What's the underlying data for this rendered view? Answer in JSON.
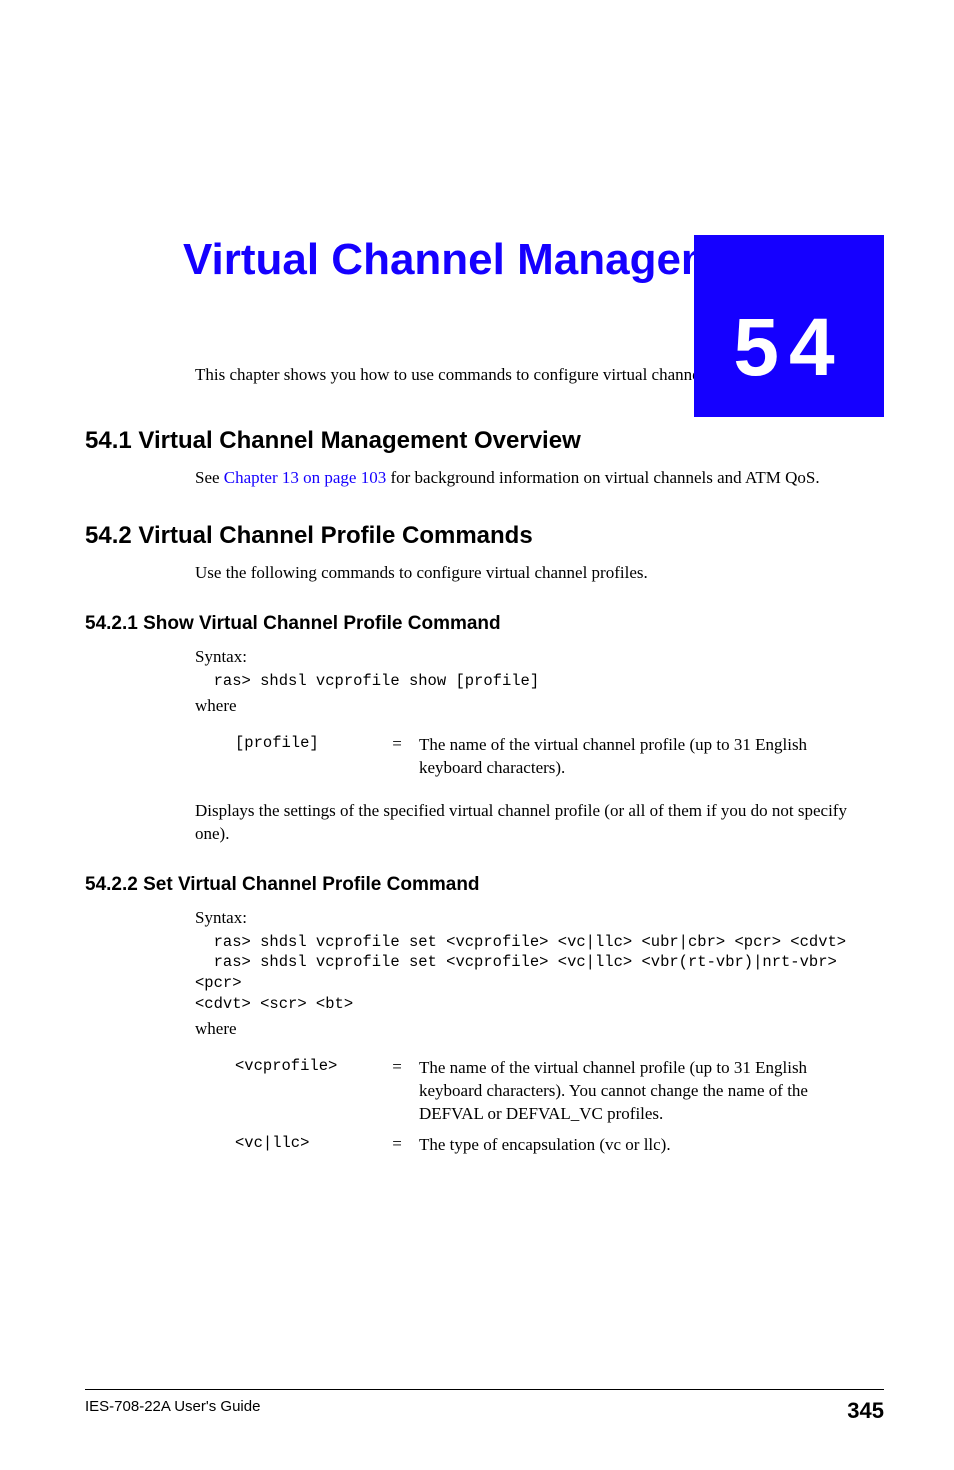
{
  "chapter": {
    "number": "54",
    "title": "Virtual Channel Management",
    "intro": "This chapter shows you how to use commands to configure virtual channels."
  },
  "sections": {
    "s1": {
      "heading": "54.1  Virtual Channel Management Overview",
      "text_pre": "See ",
      "link": "Chapter 13 on page 103",
      "text_post": " for background information on virtual channels and ATM QoS."
    },
    "s2": {
      "heading": "54.2  Virtual Channel Profile Commands",
      "text": "Use the following commands to configure virtual channel profiles."
    },
    "s21": {
      "heading": "54.2.1  Show Virtual Channel Profile Command",
      "syntax_label": "Syntax:",
      "code": "  ras> shdsl vcprofile show [profile]",
      "where_label": "where",
      "params": [
        {
          "name": "[profile]",
          "eq": "=",
          "desc": "The name of the virtual channel profile (up to 31 English keyboard characters)."
        }
      ],
      "after": "Displays the settings of the specified virtual channel profile (or all of them if you do not specify one)."
    },
    "s22": {
      "heading": "54.2.2  Set Virtual Channel Profile Command",
      "syntax_label": "Syntax:",
      "code": "  ras> shdsl vcprofile set <vcprofile> <vc|llc> <ubr|cbr> <pcr> <cdvt>\n  ras> shdsl vcprofile set <vcprofile> <vc|llc> <vbr(rt-vbr)|nrt-vbr> <pcr> \n<cdvt> <scr> <bt>",
      "where_label": "where",
      "params": [
        {
          "name": "<vcprofile>",
          "eq": "=",
          "desc": "The name of the virtual channel profile (up to 31 English keyboard characters). You cannot change the name of the DEFVAL or DEFVAL_VC profiles."
        },
        {
          "name": "<vc|llc>",
          "eq": "=",
          "desc": "The type of encapsulation (vc or llc)."
        }
      ]
    }
  },
  "footer": {
    "guide": "IES-708-22A User's Guide",
    "page": "345"
  }
}
